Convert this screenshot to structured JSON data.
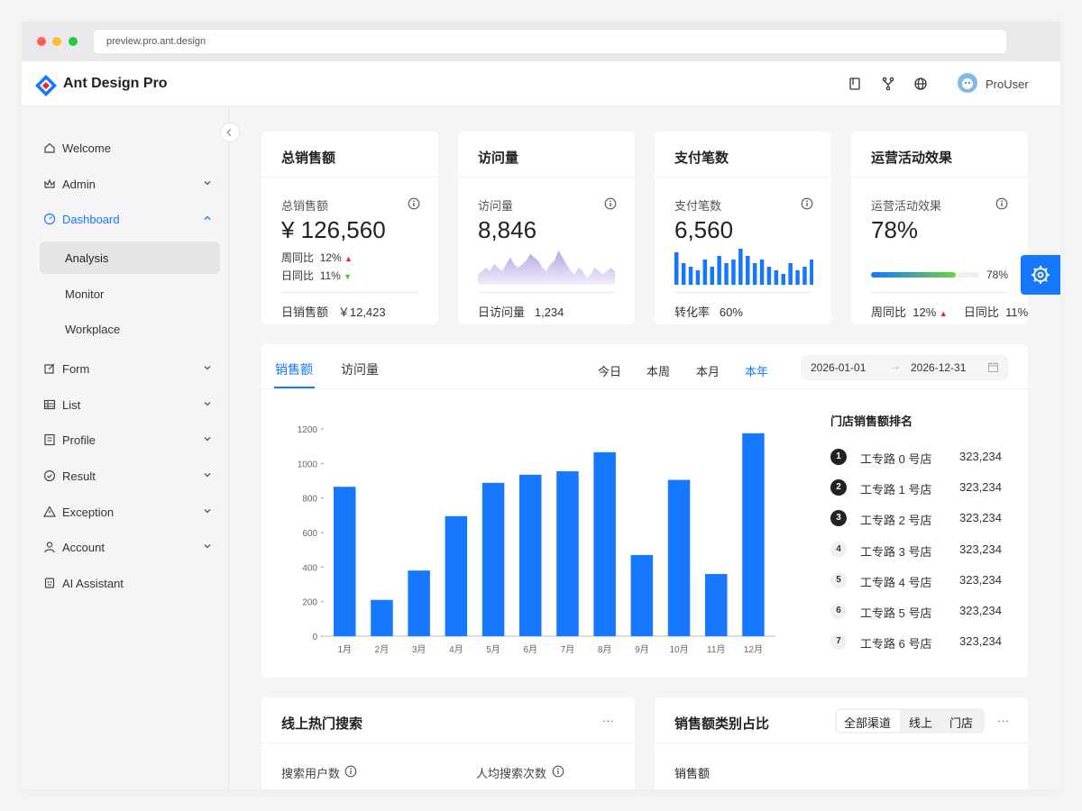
{
  "browser": {
    "url": "preview.pro.ant.design"
  },
  "header": {
    "app_title": "Ant Design Pro",
    "user_name": "ProUser"
  },
  "sidebar": {
    "items": [
      {
        "label": "Welcome"
      },
      {
        "label": "Admin"
      },
      {
        "label": "Dashboard"
      },
      {
        "label": "Form"
      },
      {
        "label": "List"
      },
      {
        "label": "Profile"
      },
      {
        "label": "Result"
      },
      {
        "label": "Exception"
      },
      {
        "label": "Account"
      },
      {
        "label": "AI Assistant"
      }
    ],
    "dashboard_children": [
      {
        "label": "Analysis"
      },
      {
        "label": "Monitor"
      },
      {
        "label": "Workplace"
      }
    ]
  },
  "stats": {
    "sales": {
      "title": "总销售额",
      "label": "总销售额",
      "value": "¥ 126,560",
      "week_label": "周同比",
      "week_value": "12%",
      "day_label": "日同比",
      "day_value": "11%",
      "footer_label": "日销售额",
      "footer_value": "￥12,423"
    },
    "visits": {
      "title": "访问量",
      "label": "访问量",
      "value": "8,846",
      "footer_label": "日访问量",
      "footer_value": "1,234"
    },
    "payments": {
      "title": "支付笔数",
      "label": "支付笔数",
      "value": "6,560",
      "footer_label": "转化率",
      "footer_value": "60%"
    },
    "ops": {
      "title": "运营活动效果",
      "label": "运营活动效果",
      "value": "78%",
      "progress_percent": 78,
      "progress_text": "78%",
      "week_label": "周同比",
      "week_value": "12%",
      "day_label": "日同比",
      "day_value": "11%"
    }
  },
  "sales_panel": {
    "tabs": [
      "销售额",
      "访问量"
    ],
    "ranges": [
      "今日",
      "本周",
      "本月",
      "本年"
    ],
    "active_range": "本年",
    "date_start": "2026-01-01",
    "date_end": "2026-12-31",
    "ranking_title": "门店销售额排名",
    "ranking": [
      {
        "rank": "1",
        "name": "工专路 0 号店",
        "value": "323,234"
      },
      {
        "rank": "2",
        "name": "工专路 1 号店",
        "value": "323,234"
      },
      {
        "rank": "3",
        "name": "工专路 2 号店",
        "value": "323,234"
      },
      {
        "rank": "4",
        "name": "工专路 3 号店",
        "value": "323,234"
      },
      {
        "rank": "5",
        "name": "工专路 4 号店",
        "value": "323,234"
      },
      {
        "rank": "6",
        "name": "工专路 5 号店",
        "value": "323,234"
      },
      {
        "rank": "7",
        "name": "工专路 6 号店",
        "value": "323,234"
      }
    ]
  },
  "search_panel": {
    "title": "线上热门搜索",
    "more": "···",
    "metric1": "搜索用户数",
    "metric2": "人均搜索次数"
  },
  "category_panel": {
    "title": "销售额类别占比",
    "segments": [
      "全部渠道",
      "线上",
      "门店"
    ],
    "more": "···",
    "sub_label": "销售额"
  },
  "colors": {
    "primary": "#1677ff",
    "up": "#f5222d",
    "down": "#52c41a",
    "area": "#a88de0"
  },
  "chart_data": {
    "type": "bar",
    "categories": [
      "1月",
      "2月",
      "3月",
      "4月",
      "5月",
      "6月",
      "7月",
      "8月",
      "9月",
      "10月",
      "11月",
      "12月"
    ],
    "values": [
      865,
      210,
      380,
      695,
      888,
      935,
      955,
      1065,
      470,
      905,
      360,
      1175
    ],
    "ylim": [
      0,
      1200
    ],
    "yticks": [
      0,
      200,
      400,
      600,
      800,
      1000,
      1200
    ],
    "ytick_labels": [
      "0",
      "200",
      "400",
      "600",
      "800",
      "1000",
      "1200"
    ],
    "grid": false,
    "xlabel": "",
    "ylabel": ""
  },
  "visits_spark": [
    3,
    4,
    5,
    4,
    6,
    5,
    4,
    6,
    8,
    6,
    5,
    6,
    7,
    9,
    8,
    7,
    5,
    4,
    6,
    7,
    10,
    8,
    6,
    4,
    3,
    5,
    4,
    2,
    3,
    5,
    4,
    3,
    4,
    5,
    4
  ],
  "payments_spark": [
    9,
    6,
    5,
    4,
    7,
    5,
    8,
    6,
    7,
    10,
    8,
    6,
    7,
    5,
    4,
    3,
    6,
    4,
    5,
    7
  ]
}
